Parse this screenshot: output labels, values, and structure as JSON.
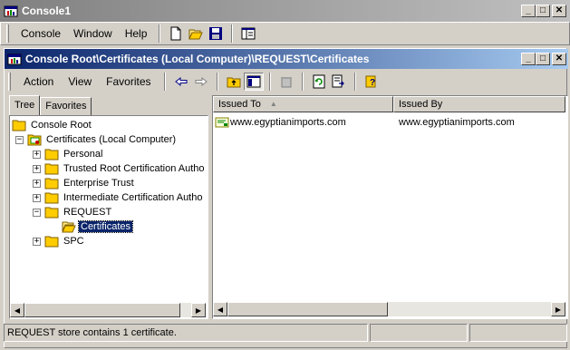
{
  "window": {
    "title": "Console1"
  },
  "main_menu": {
    "items": [
      "Console",
      "Window",
      "Help"
    ]
  },
  "child_window": {
    "title": "Console Root\\Certificates (Local Computer)\\REQUEST\\Certificates",
    "menu_items": [
      "Action",
      "View",
      "Favorites"
    ]
  },
  "tabs": [
    "Tree",
    "Favorites"
  ],
  "tree": {
    "items": [
      {
        "label": "Console Root",
        "icon": "folder-icon"
      },
      {
        "label": "Certificates (Local Computer)",
        "icon": "certificates-snapin-icon"
      },
      {
        "label": "Personal",
        "icon": "folder-icon"
      },
      {
        "label": "Trusted Root Certification Autho",
        "icon": "folder-icon"
      },
      {
        "label": "Enterprise Trust",
        "icon": "folder-icon"
      },
      {
        "label": "Intermediate Certification Autho",
        "icon": "folder-icon"
      },
      {
        "label": "REQUEST",
        "icon": "folder-icon"
      },
      {
        "label": "Certificates",
        "icon": "open-folder-icon"
      },
      {
        "label": "SPC",
        "icon": "folder-icon"
      }
    ]
  },
  "list": {
    "columns": [
      "Issued To",
      "Issued By"
    ],
    "rows": [
      {
        "issued_to": "www.egyptianimports.com",
        "issued_by": "www.egyptianimports.com"
      }
    ]
  },
  "status": {
    "text": "REQUEST store contains 1 certificate."
  }
}
